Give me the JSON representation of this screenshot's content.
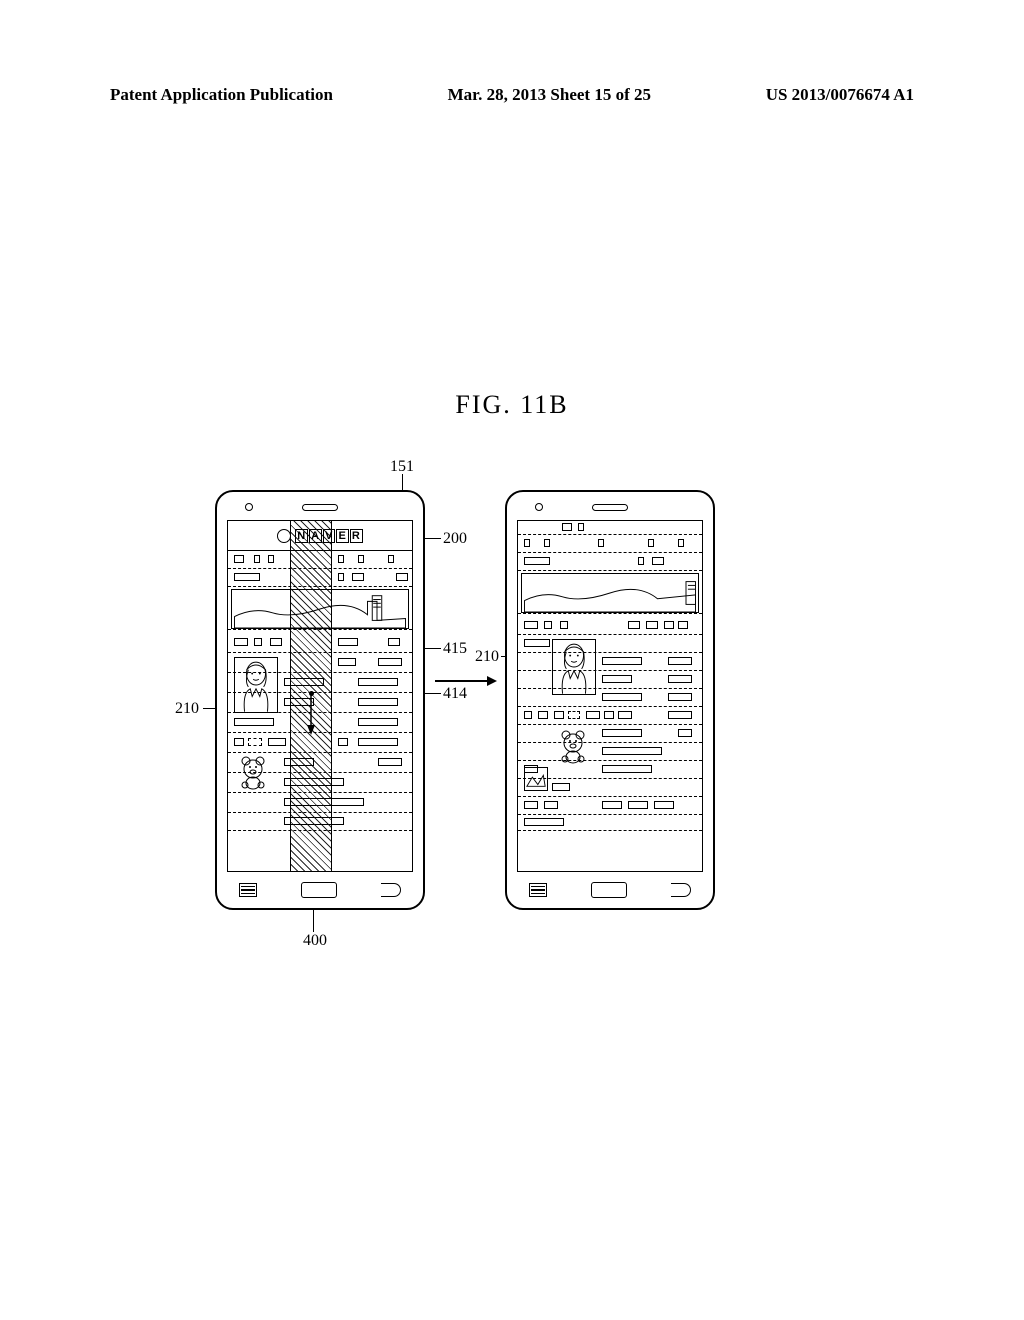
{
  "header": {
    "left": "Patent Application Publication",
    "center": "Mar. 28, 2013  Sheet 15 of 25",
    "right": "US 2013/0076674 A1"
  },
  "figure_label": "FIG.  11B",
  "logo_text": "NAVER",
  "callouts": {
    "c151": "151",
    "c200": "200",
    "c415": "415",
    "c210_left": "210",
    "c210_right": "210",
    "c414": "414",
    "c400": "400"
  }
}
